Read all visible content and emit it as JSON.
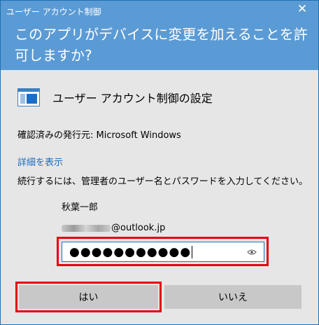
{
  "dialog": {
    "title": "ユーザー アカウント制御",
    "question": "このアプリがデバイスに変更を加えることを許可しますか?",
    "close_glyph": "✕"
  },
  "app": {
    "name": "ユーザー アカウント制御の設定",
    "icon": "window-icon"
  },
  "publisher": "確認済みの発行元: Microsoft Windows",
  "details_link": "詳細を表示",
  "instruction": "続行するには、管理者のユーザー名とパスワードを入力してください。",
  "account": {
    "username": "秋葉一郎",
    "email_visible": "@outlook.jp"
  },
  "password": {
    "masked": "●●●●●●●●●●●",
    "reveal_icon": "eye-icon"
  },
  "buttons": {
    "yes": "はい",
    "no": "いいえ"
  },
  "colors": {
    "header": "#5b9bd5",
    "body": "#e6e6e6",
    "highlight": "#e50012",
    "link": "#1a6ec5"
  }
}
